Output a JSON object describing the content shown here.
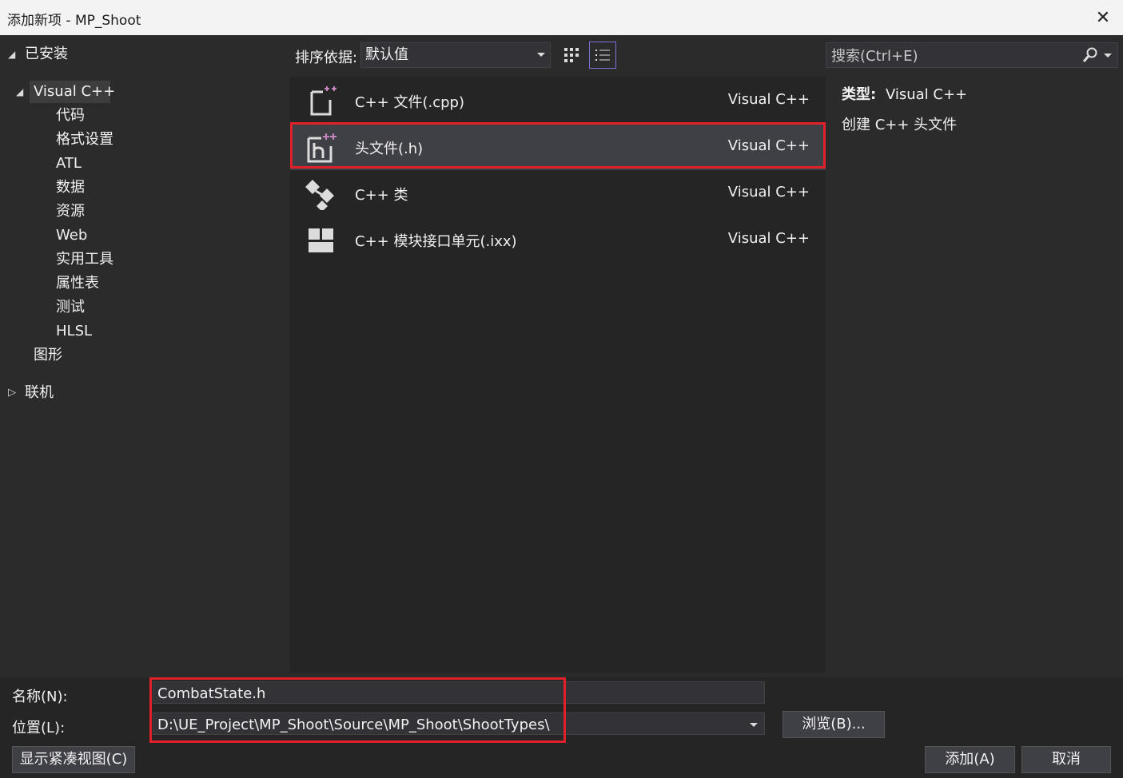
{
  "window": {
    "title": "添加新项 - MP_Shoot",
    "close_icon": "✕"
  },
  "sidebar": {
    "installed": "已安装",
    "visual_cpp": "Visual C++",
    "children": [
      "代码",
      "格式设置",
      "ATL",
      "数据",
      "资源",
      "Web",
      "实用工具",
      "属性表",
      "测试",
      "HLSL"
    ],
    "graphics": "图形",
    "online": "联机"
  },
  "toolbar": {
    "sort_label": "排序依据:",
    "sort_value": "默认值"
  },
  "search": {
    "placeholder": "搜索(Ctrl+E)"
  },
  "templates": [
    {
      "name": "C++ 文件(.cpp)",
      "lang": "Visual C++",
      "icon": "cpp-file-icon"
    },
    {
      "name": "头文件(.h)",
      "lang": "Visual C++",
      "icon": "header-file-icon",
      "selected": true
    },
    {
      "name": "C++ 类",
      "lang": "Visual C++",
      "icon": "class-icon"
    },
    {
      "name": "C++ 模块接口单元(.ixx)",
      "lang": "Visual C++",
      "icon": "module-icon"
    }
  ],
  "info": {
    "type_label": "类型:",
    "type_value": "Visual C++",
    "description": "创建 C++ 头文件"
  },
  "form": {
    "name_label": "名称(N):",
    "name_value": "CombatState.h",
    "location_label": "位置(L):",
    "location_value": "D:\\UE_Project\\MP_Shoot\\Source\\MP_Shoot\\ShootTypes\\",
    "browse": "浏览(B)..."
  },
  "buttons": {
    "compact": "显示紧凑视图(C)",
    "add": "添加(A)",
    "cancel": "取消"
  },
  "colors": {
    "highlight": "#e0202a",
    "accent": "#7b73d8",
    "icon_plus": "#c586c0"
  }
}
